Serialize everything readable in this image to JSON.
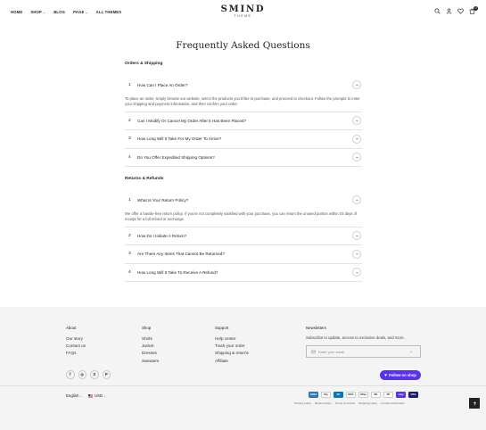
{
  "header": {
    "nav": [
      {
        "label": "HOME",
        "dropdown": false
      },
      {
        "label": "SHOP",
        "dropdown": true
      },
      {
        "label": "BLOG",
        "dropdown": false
      },
      {
        "label": "PAGE",
        "dropdown": true
      },
      {
        "label": "ALL THEMES",
        "dropdown": false
      }
    ],
    "logo": "SMIND",
    "logo_sub": "THEME",
    "cart_count": "0",
    "icons": [
      "search-icon",
      "account-icon",
      "wishlist-icon",
      "cart-icon"
    ]
  },
  "faq": {
    "title": "Frequently Asked Questions",
    "sections": [
      {
        "title": "Orders & Shipping",
        "items": [
          {
            "num": "1",
            "question": "How Can I Place An Order?",
            "open": true,
            "answer": "To place an order, simply browse our website, select the products you'd like to purchase, and proceed to checkout. Follow the prompts to enter your shipping and payment information, and then confirm your order."
          },
          {
            "num": "2",
            "question": "Can I Modify Or Cancel My Order After It Has Been Placed?",
            "open": false
          },
          {
            "num": "3",
            "question": "How Long Will It Take For My Order To Arrive?",
            "open": false
          },
          {
            "num": "4",
            "question": "Do You Offer Expedited Shipping Options?",
            "open": false
          }
        ]
      },
      {
        "title": "Returns & Refunds",
        "items": [
          {
            "num": "1",
            "question": "What Is Your Return Policy?",
            "open": true,
            "answer": "We offer a hassle-free return policy. If you're not completely satisfied with your purchase, you can return the unused portion within 03 days of receipt for a full refund or exchange."
          },
          {
            "num": "2",
            "question": "How Do I Initiate A Return?",
            "open": false
          },
          {
            "num": "3",
            "question": "Are There Any Items That Cannot Be Returned?",
            "open": false
          },
          {
            "num": "4",
            "question": "How Long Will It Take To Receive A Refund?",
            "open": false
          }
        ]
      }
    ]
  },
  "footer": {
    "columns": [
      {
        "title": "About",
        "links": [
          "Our story",
          "Contact us",
          "FAQs"
        ]
      },
      {
        "title": "Shop",
        "links": [
          "Shirts",
          "Jacket",
          "Dresses",
          "Sweaters"
        ]
      },
      {
        "title": "Support",
        "links": [
          "Help center",
          "Track your order",
          "Shipping & returns",
          "Affiliate"
        ]
      }
    ],
    "newsletter": {
      "title": "Newsletters",
      "text": "Subscribe to update, access to exclusive deals, and more.",
      "placeholder": "Enter your email"
    },
    "follow_label": "Follow on shop",
    "socials": [
      "facebook-icon",
      "instagram-icon",
      "x-icon",
      "pinterest-icon"
    ],
    "language": "English",
    "currency": "USD",
    "payments": [
      {
        "name": "Amex",
        "color": "#2e77bc",
        "text": "AMEX"
      },
      {
        "name": "Apple Pay",
        "color": "#ffffff",
        "text": "Pay"
      },
      {
        "name": "Diners Club",
        "color": "#0079be",
        "text": "DC"
      },
      {
        "name": "Discover",
        "color": "#ffffff",
        "text": "DISC"
      },
      {
        "name": "Google Pay",
        "color": "#ffffff",
        "text": "GPay"
      },
      {
        "name": "Mastercard",
        "color": "#ffffff",
        "text": "MC"
      },
      {
        "name": "PayPal",
        "color": "#ffffff",
        "text": "PP"
      },
      {
        "name": "Shop Pay",
        "color": "#5a31f4",
        "text": "shop"
      },
      {
        "name": "Visa",
        "color": "#1a1f71",
        "text": "VISA"
      }
    ],
    "policies": [
      "Privacy policy",
      "Refund policy",
      "Terms of service",
      "Shipping policy",
      "Contact information"
    ]
  }
}
